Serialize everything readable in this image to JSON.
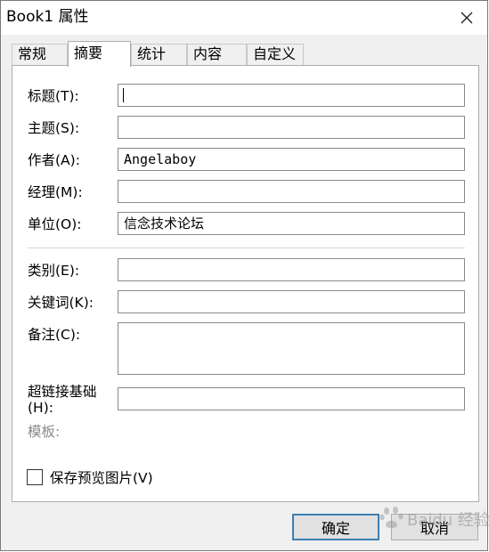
{
  "window": {
    "title": "Book1 属性"
  },
  "tabs": [
    {
      "label": "常规"
    },
    {
      "label": "摘要"
    },
    {
      "label": "统计"
    },
    {
      "label": "内容"
    },
    {
      "label": "自定义"
    }
  ],
  "active_tab": "摘要",
  "fields": {
    "title": {
      "label": "标题(T):",
      "value": ""
    },
    "subject": {
      "label": "主题(S):",
      "value": ""
    },
    "author": {
      "label": "作者(A):",
      "value": "Angelaboy"
    },
    "manager": {
      "label": "经理(M):",
      "value": ""
    },
    "company": {
      "label": "单位(O):",
      "value": "信念技术论坛"
    },
    "category": {
      "label": "类别(E):",
      "value": ""
    },
    "keywords": {
      "label": "关键词(K):",
      "value": ""
    },
    "comments": {
      "label": "备注(C):",
      "value": ""
    },
    "hyperlink_base": {
      "label_line1": "超链接基础",
      "label_line2": "(H):",
      "value": ""
    },
    "template": {
      "label": "模板:"
    }
  },
  "save_preview": {
    "label": "保存预览图片(V)",
    "checked": false
  },
  "buttons": {
    "ok": "确定",
    "cancel": "取消"
  },
  "watermark": {
    "text": "Baidu 经验"
  }
}
